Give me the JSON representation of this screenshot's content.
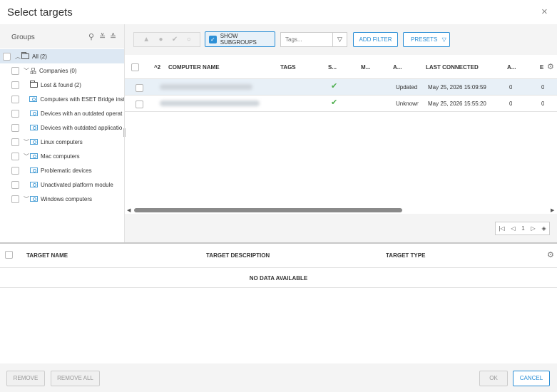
{
  "dialog": {
    "title": "Select targets",
    "close_label": "×"
  },
  "groups": {
    "title": "Groups",
    "search_glyph": "⚲",
    "collapse_glyph": "≚",
    "expand_glyph": "≙",
    "tree": [
      {
        "label": "All (2)",
        "chevron": "︿",
        "icon": "folder-plain",
        "indent": 0,
        "selected": true
      },
      {
        "label": "Companies (0)",
        "chevron": "﹀",
        "icon": "sitemap",
        "indent": 1
      },
      {
        "label": "Lost & found (2)",
        "chevron": "",
        "icon": "folder-plain",
        "indent": 1
      },
      {
        "label": "Computers with ESET Bridge inst",
        "chevron": "",
        "icon": "folder-dyn",
        "indent": 1
      },
      {
        "label": "Devices with an outdated operat",
        "chevron": "",
        "icon": "folder-dyn",
        "indent": 1
      },
      {
        "label": "Devices with outdated applicatio",
        "chevron": "",
        "icon": "folder-dyn",
        "indent": 1
      },
      {
        "label": "Linux computers",
        "chevron": "﹀",
        "icon": "folder-dyn",
        "indent": 1
      },
      {
        "label": "Mac computers",
        "chevron": "﹀",
        "icon": "folder-dyn",
        "indent": 1
      },
      {
        "label": "Problematic devices",
        "chevron": "",
        "icon": "folder-dyn",
        "indent": 1
      },
      {
        "label": "Unactivated platform module",
        "chevron": "",
        "icon": "folder-dyn",
        "indent": 1
      },
      {
        "label": "Windows computers",
        "chevron": "﹀",
        "icon": "folder-dyn",
        "indent": 1
      }
    ]
  },
  "toolbar": {
    "status_icons": [
      "▲",
      "●",
      "✔",
      "○"
    ],
    "show_subgroups": "SHOW SUBGROUPS",
    "tags_placeholder": "Tags...",
    "add_filter": "ADD FILTER",
    "presets": "PRESETS"
  },
  "computers": {
    "columns": {
      "sort": "^2",
      "name": "COMPUTER NAME",
      "tags": "TAGS",
      "s": "S...",
      "m": "M...",
      "a": "A...",
      "last_connected": "LAST CONNECTED",
      "a2": "A...",
      "e": "E"
    },
    "rows": [
      {
        "status": "✔",
        "activity": "Updated",
        "last_connected": "May 25, 2026 15:09:59",
        "a": "0",
        "e": "0"
      },
      {
        "status": "✔",
        "activity": "Unknown",
        "last_connected": "May 25, 2026 15:55:20",
        "a": "0",
        "e": "0"
      }
    ],
    "pager": {
      "page": "1"
    }
  },
  "targets": {
    "columns": {
      "name": "TARGET NAME",
      "description": "TARGET DESCRIPTION",
      "type": "TARGET TYPE"
    },
    "empty": "NO DATA AVAILABLE"
  },
  "footer": {
    "remove": "REMOVE",
    "remove_all": "REMOVE ALL",
    "ok": "OK",
    "cancel": "CANCEL"
  },
  "colors": {
    "accent": "#2c8fd6",
    "ok_green": "#4cae4c",
    "selected_row": "#e8f0f7"
  }
}
